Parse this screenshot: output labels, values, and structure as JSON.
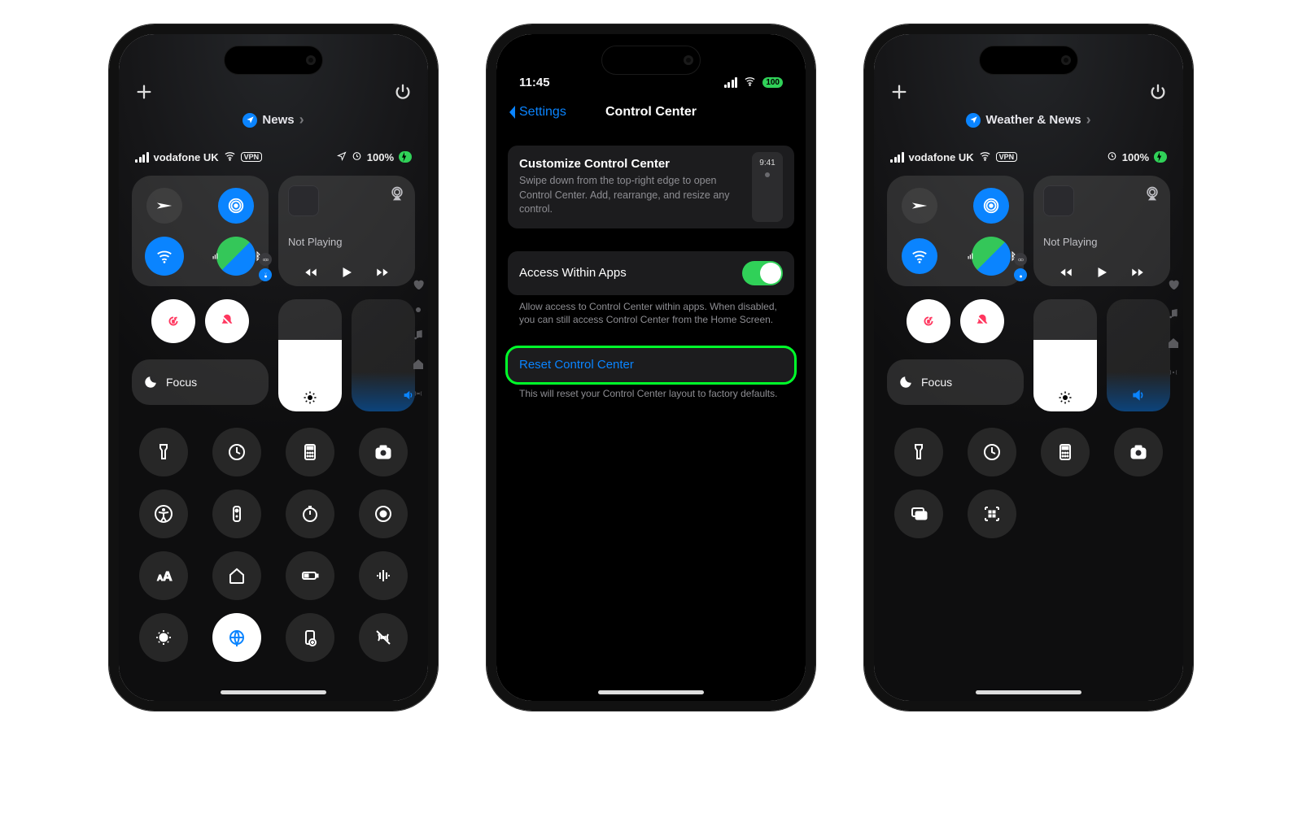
{
  "left": {
    "breadcrumb": "News",
    "carrier": "vodafone UK",
    "vpn_tag": "VPN",
    "battery_text": "100%",
    "not_playing": "Not Playing",
    "focus_label": "Focus",
    "toggles": [
      "flashlight-icon",
      "timer-icon",
      "calculator-icon",
      "camera-icon",
      "accessibility-icon",
      "remote-icon",
      "stopwatch-icon",
      "screen-record-icon",
      "text-size-icon",
      "home-icon",
      "low-power-icon",
      "sound-recognition-icon",
      "night-shift-icon",
      "translate-icon",
      "wallpaper-icon",
      "signal-off-icon"
    ]
  },
  "middle": {
    "time": "11:45",
    "battery_tag": "100",
    "nav_back": "Settings",
    "nav_title": "Control Center",
    "card_title": "Customize Control Center",
    "card_desc": "Swipe down from the top-right edge to open Control Center. Add, rearrange, and resize any control.",
    "preview_time": "9:41",
    "switch_label": "Access Within Apps",
    "switch_note": "Allow access to Control Center within apps. When disabled, you can still access Control Center from the Home Screen.",
    "reset_label": "Reset Control Center",
    "reset_note": "This will reset your Control Center layout to factory defaults."
  },
  "right": {
    "breadcrumb": "Weather & News",
    "carrier": "vodafone UK",
    "vpn_tag": "VPN",
    "battery_text": "100%",
    "not_playing": "Not Playing",
    "focus_label": "Focus",
    "toggles": [
      "flashlight-icon",
      "timer-icon",
      "calculator-icon",
      "camera-icon",
      "screen-mirror-icon",
      "qr-code-icon"
    ]
  }
}
